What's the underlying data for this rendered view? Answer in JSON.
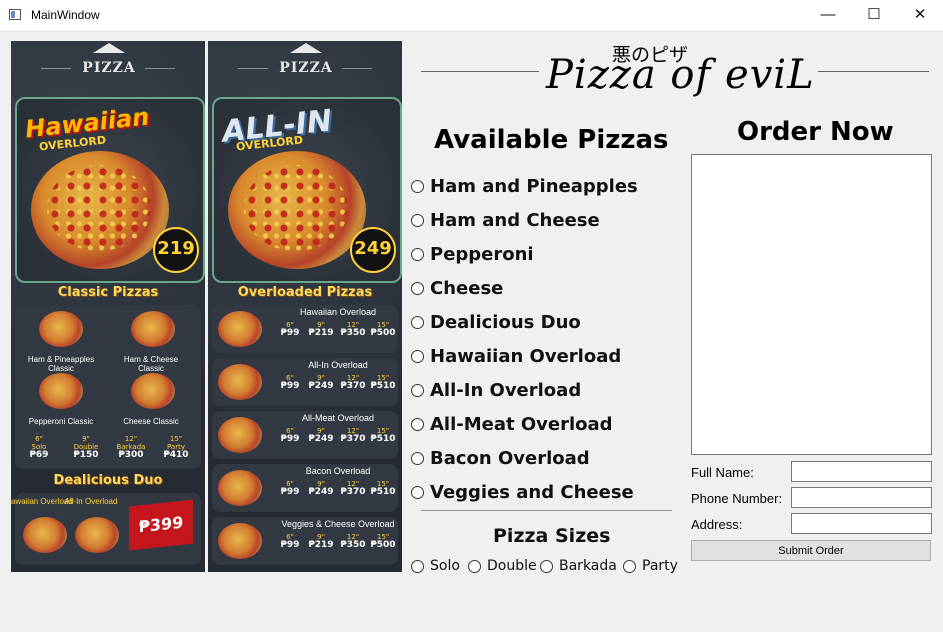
{
  "window": {
    "title": "MainWindow",
    "minimize_icon": "minimize-icon",
    "maximize_icon": "maximize-icon",
    "close_icon": "close-icon"
  },
  "logo": {
    "japanese": "悪のピザ",
    "title": "Pizza of eviL"
  },
  "menu_left": {
    "brand": "PIZZA",
    "hero_title": "Hawaiian",
    "hero_subtitle": "OVERLORD",
    "hero_price": "219",
    "classic_heading": "Classic Pizzas",
    "classic_items": [
      "Ham & Pineapples Classic",
      "Ham & Cheese Classic",
      "Pepperoni Classic",
      "Cheese Classic"
    ],
    "classic_prices": [
      {
        "size": "6\"",
        "name": "Solo",
        "price": "₱69"
      },
      {
        "size": "9\"",
        "name": "Double",
        "price": "₱150"
      },
      {
        "size": "12\"",
        "name": "Barkada",
        "price": "₱300"
      },
      {
        "size": "15\"",
        "name": "Party",
        "price": "₱410"
      }
    ],
    "duo_heading": "Dealicious Duo",
    "duo_labels": [
      "Hawaiian Overload",
      "All-In Overload"
    ],
    "duo_price": "₱399"
  },
  "menu_right": {
    "brand": "PIZZA",
    "hero_title": "ALL-IN",
    "hero_subtitle": "OVERLORD",
    "hero_price": "249",
    "overloaded_heading": "Overloaded Pizzas",
    "items": [
      {
        "name": "Hawaiian Overload",
        "prices": [
          "₱99",
          "₱219",
          "₱350",
          "₱500"
        ]
      },
      {
        "name": "All-In Overload",
        "prices": [
          "₱99",
          "₱249",
          "₱370",
          "₱510"
        ]
      },
      {
        "name": "All-Meat Overload",
        "prices": [
          "₱99",
          "₱249",
          "₱370",
          "₱510"
        ]
      },
      {
        "name": "Bacon Overload",
        "prices": [
          "₱99",
          "₱249",
          "₱370",
          "₱510"
        ]
      },
      {
        "name": "Veggies & Cheese Overload",
        "prices": [
          "₱99",
          "₱219",
          "₱350",
          "₱500"
        ]
      }
    ]
  },
  "available": {
    "title": "Available Pizzas",
    "options": [
      "Ham and Pineapples",
      "Ham and Cheese",
      "Pepperoni",
      "Cheese",
      "Dealicious Duo",
      "Hawaiian Overload",
      "All-In Overload",
      "All-Meat Overload",
      "Bacon Overload",
      "Veggies and Cheese"
    ]
  },
  "sizes": {
    "title": "Pizza Sizes",
    "options": [
      "Solo",
      "Double",
      "Barkada",
      "Party"
    ]
  },
  "order": {
    "title": "Order Now",
    "order_text": "",
    "full_name_label": "Full Name:",
    "full_name_value": "",
    "phone_label": "Phone Number:",
    "phone_value": "",
    "address_label": "Address:",
    "address_value": "",
    "submit_label": "Submit Order"
  }
}
